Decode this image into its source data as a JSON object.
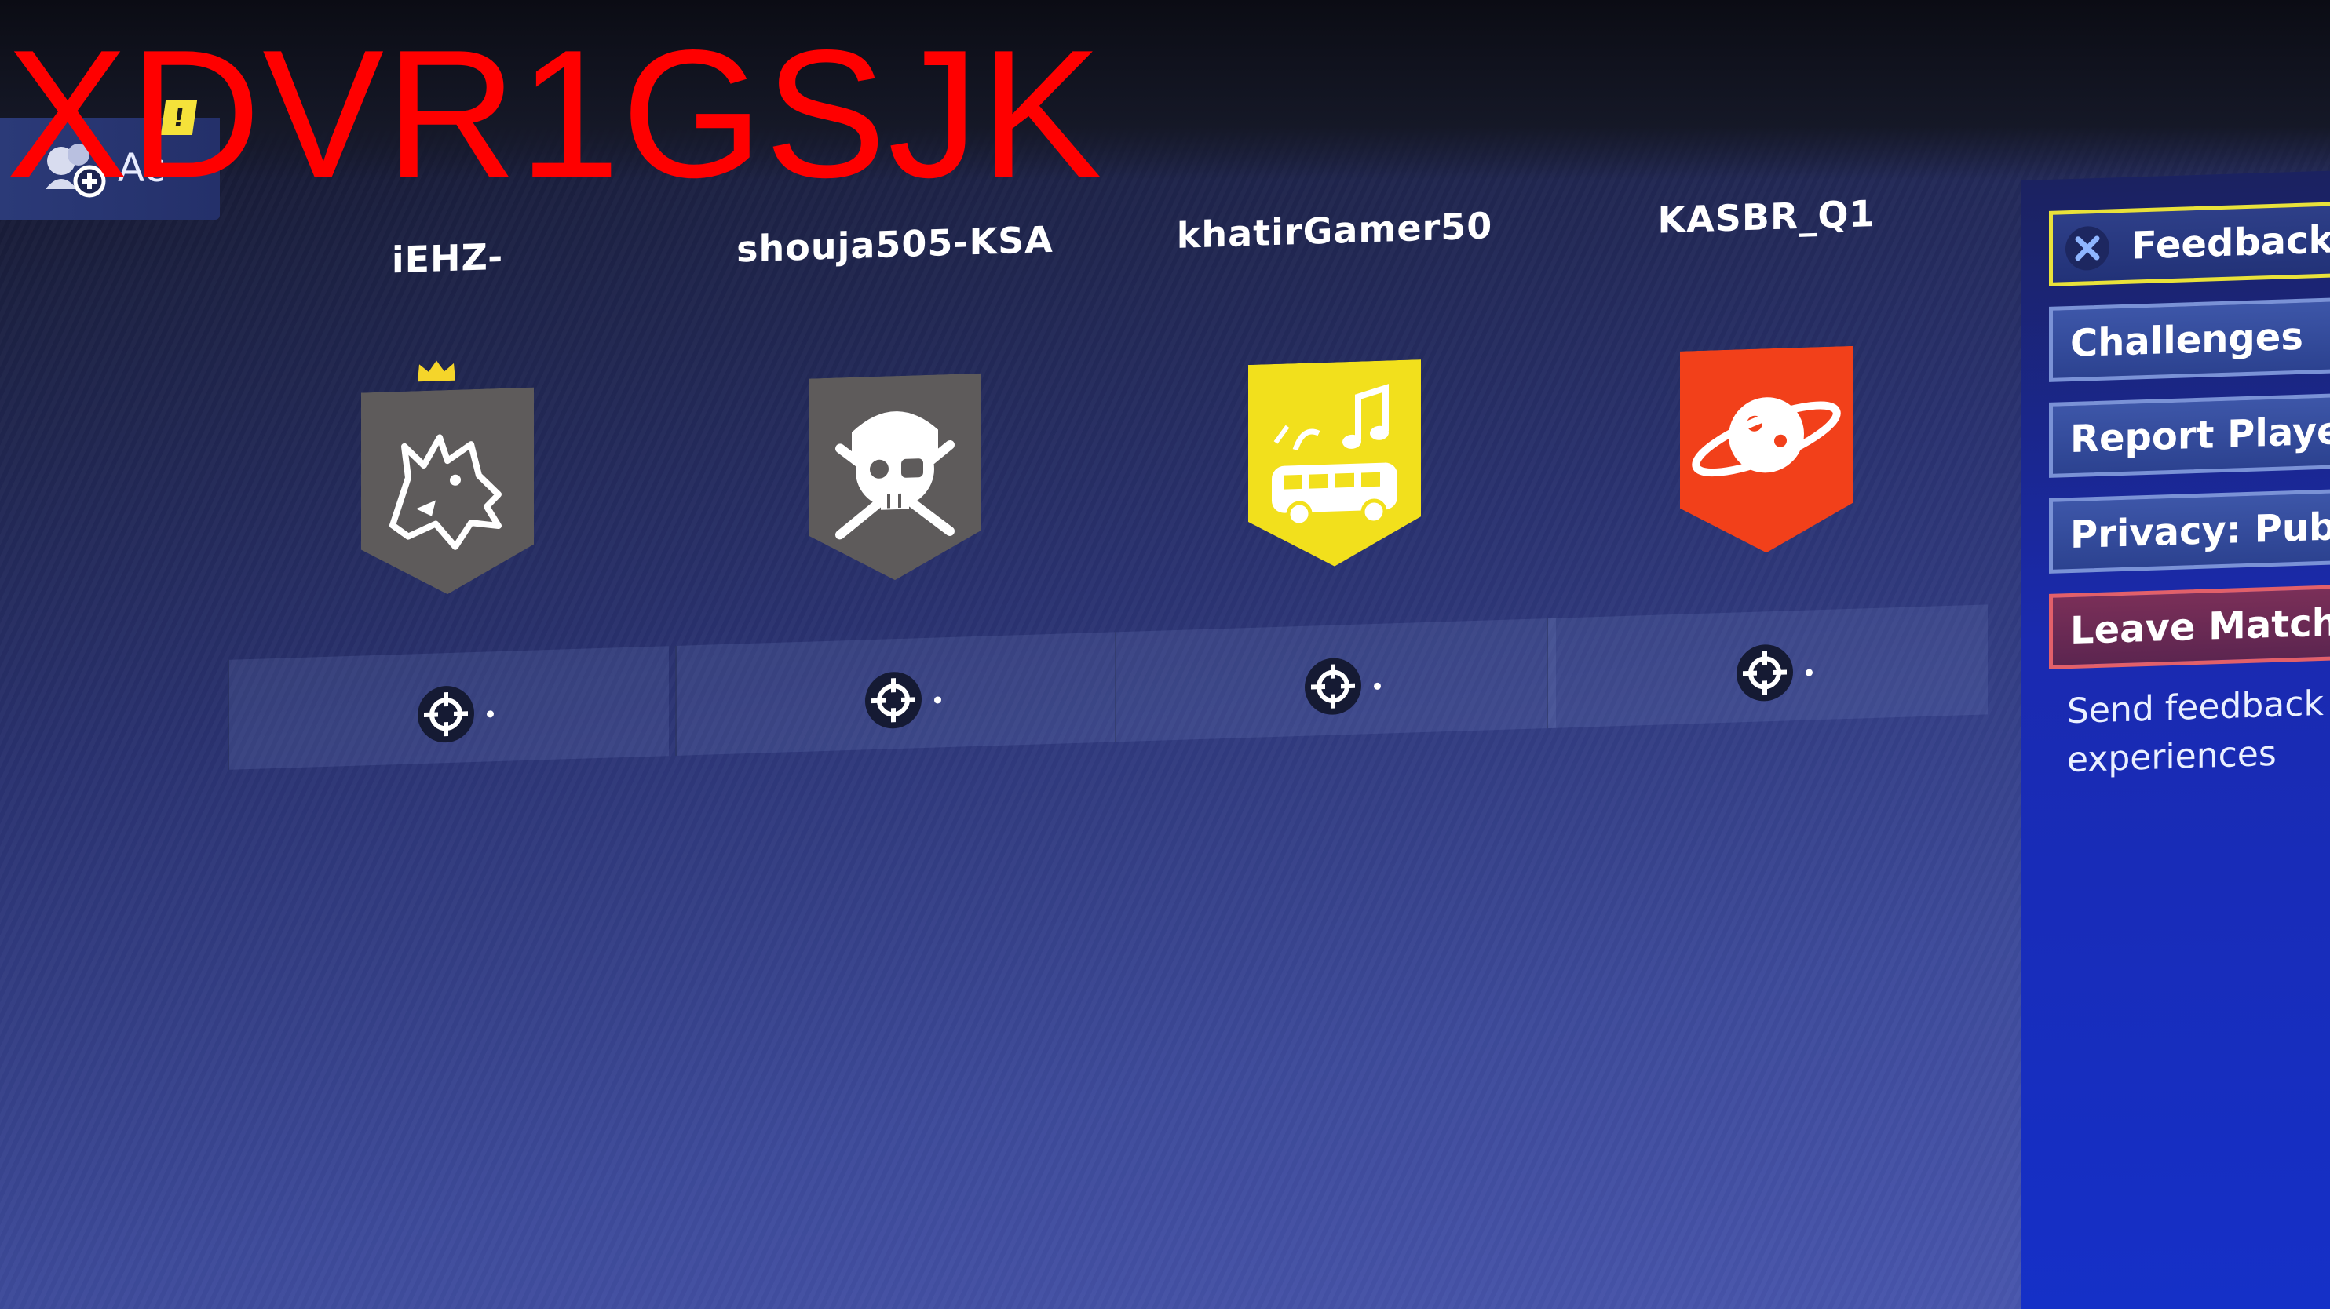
{
  "watermark": "XDVR1GSJK",
  "party_widget": {
    "notification_badge": "!",
    "label": "Ac",
    "icon": "add-friend-icon"
  },
  "players": [
    {
      "name": "iEHZ-",
      "is_leader": true,
      "banner_color": "#5e5b5b",
      "banner_icon": "wolf-icon"
    },
    {
      "name": "shouja505-KSA",
      "is_leader": false,
      "banner_color": "#5e5b5b",
      "banner_icon": "pirate-skull-icon"
    },
    {
      "name": "khatirGamer50",
      "is_leader": false,
      "banner_color": "#f2e01c",
      "banner_icon": "party-bus-icon"
    },
    {
      "name": "KASBR_Q1",
      "is_leader": false,
      "banner_color": "#f2401a",
      "banner_icon": "planet-icon"
    }
  ],
  "menu": {
    "feedback": "Feedback",
    "challenges": "Challenges",
    "report_player": "Report Player",
    "privacy": "Privacy: Public",
    "leave_match": "Leave Match",
    "description": "Send feedback a\nexperiences"
  },
  "colors": {
    "feedback_border": "#e9e23a",
    "leave_border": "#e2606a",
    "crown": "#f5d52a"
  }
}
